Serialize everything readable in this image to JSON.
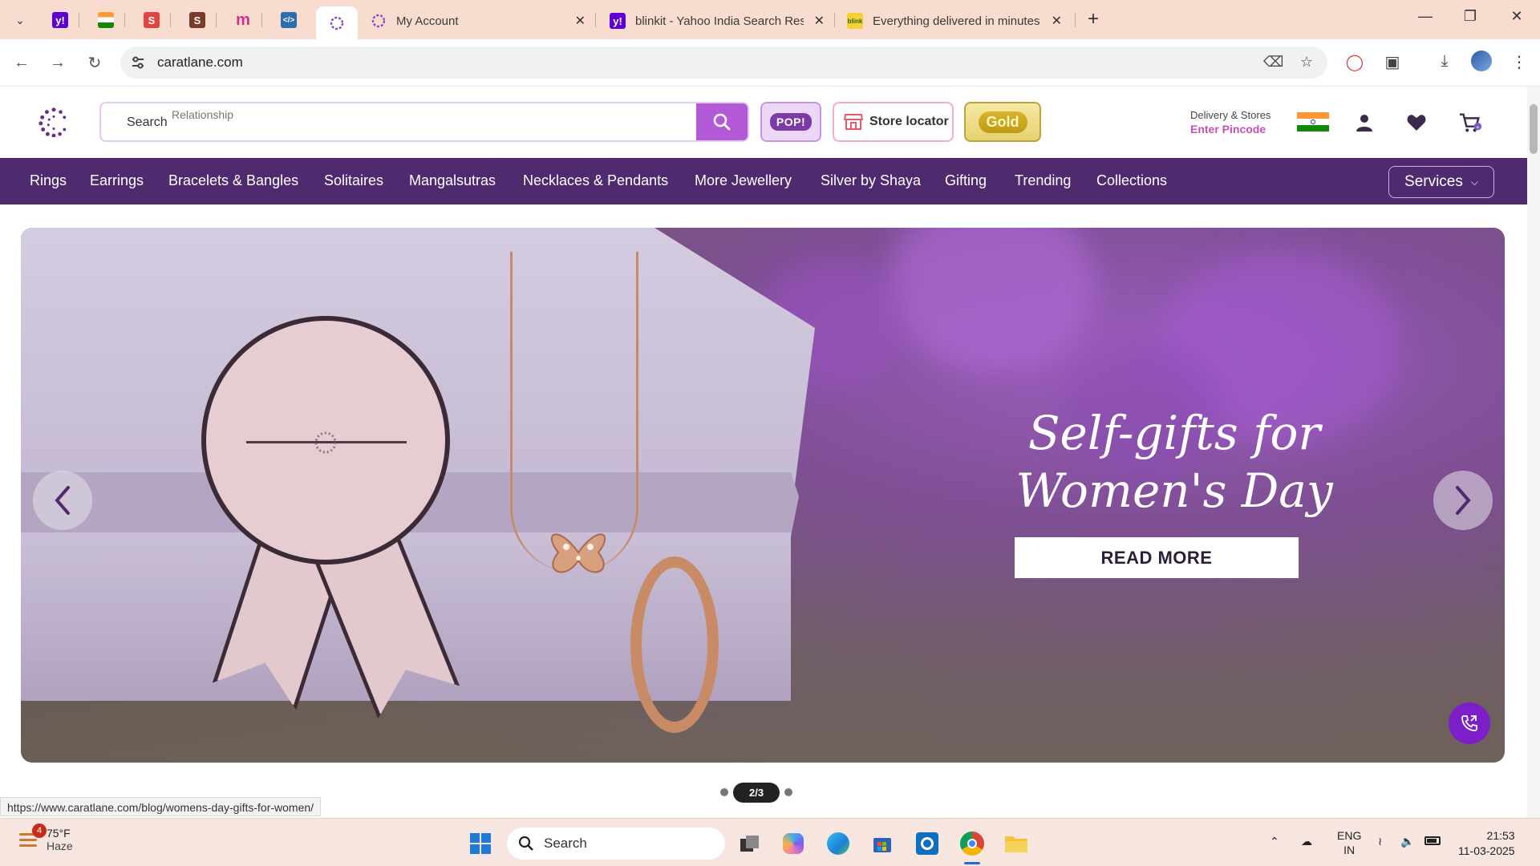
{
  "browser": {
    "tabs": [
      {
        "title": "My Account"
      },
      {
        "title": "blinkit - Yahoo India Search Res"
      },
      {
        "title": "Everything delivered in minutes"
      }
    ],
    "url": "caratlane.com",
    "status_url": "https://www.caratlane.com/blog/womens-day-gifts-for-women/"
  },
  "header": {
    "search_label": "Search",
    "search_rotating": "Relationship",
    "pop_label": "POP!",
    "store_locator": "Store locator",
    "gold_label": "Gold",
    "delivery_line1": "Delivery & Stores",
    "delivery_line2": "Enter Pincode"
  },
  "categories": [
    "Rings",
    "Earrings",
    "Bracelets & Bangles",
    "Solitaires",
    "Mangalsutras",
    "Necklaces & Pendants",
    "More Jewellery",
    "Silver by Shaya",
    "Gifting",
    "Trending",
    "Collections"
  ],
  "services_label": "Services",
  "hero": {
    "title_line1": "Self-gifts for",
    "title_line2": "Women's Day",
    "cta": "READ MORE",
    "pager": "2/3"
  },
  "taskbar": {
    "weather_temp": "75°F",
    "weather_cond": "Haze",
    "weather_badge": "4",
    "search_label": "Search",
    "lang_line1": "ENG",
    "lang_line2": "IN",
    "time": "21:53",
    "date": "11-03-2025"
  },
  "colors": {
    "nav_bg": "#4f2a6e",
    "search_accent": "#b358d6",
    "pincode": "#c54fb8",
    "fab": "#7c1fc9"
  }
}
